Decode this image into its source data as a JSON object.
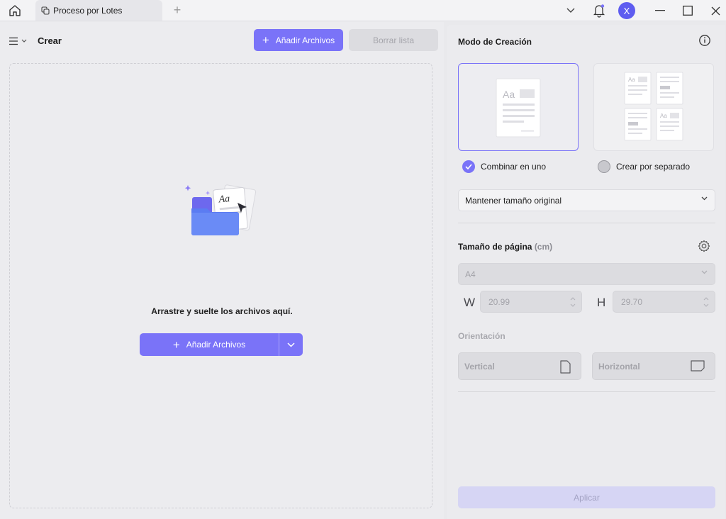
{
  "titlebar": {
    "tab_label": "Proceso por Lotes",
    "avatar_letter": "X",
    "tab_add": "+"
  },
  "left": {
    "title": "Crear",
    "add_files_label": "Añadir Archivos",
    "clear_list_label": "Borrar lista",
    "drop_text": "Arrastre y suelte los archivos aquí.",
    "drop_add_label": "Añadir Archivos",
    "plus": "+"
  },
  "right": {
    "mode_title": "Modo de Creación",
    "mode_options": [
      {
        "label": "Combinar en uno",
        "selected": true
      },
      {
        "label": "Crear por separado",
        "selected": false
      }
    ],
    "size_select_value": "Mantener tamaño original",
    "page_size_title": "Tamaño de página",
    "page_size_unit": "(cm)",
    "paper_value": "A4",
    "width_label": "W",
    "width_value": "20.99",
    "height_label": "H",
    "height_value": "29.70",
    "orientation_title": "Orientación",
    "vertical_label": "Vertical",
    "horizontal_label": "Horizontal",
    "apply_label": "Aplicar",
    "preview_text": "Aa"
  },
  "colors": {
    "accent": "#7a73f8",
    "avatar": "#5e5cf0"
  }
}
